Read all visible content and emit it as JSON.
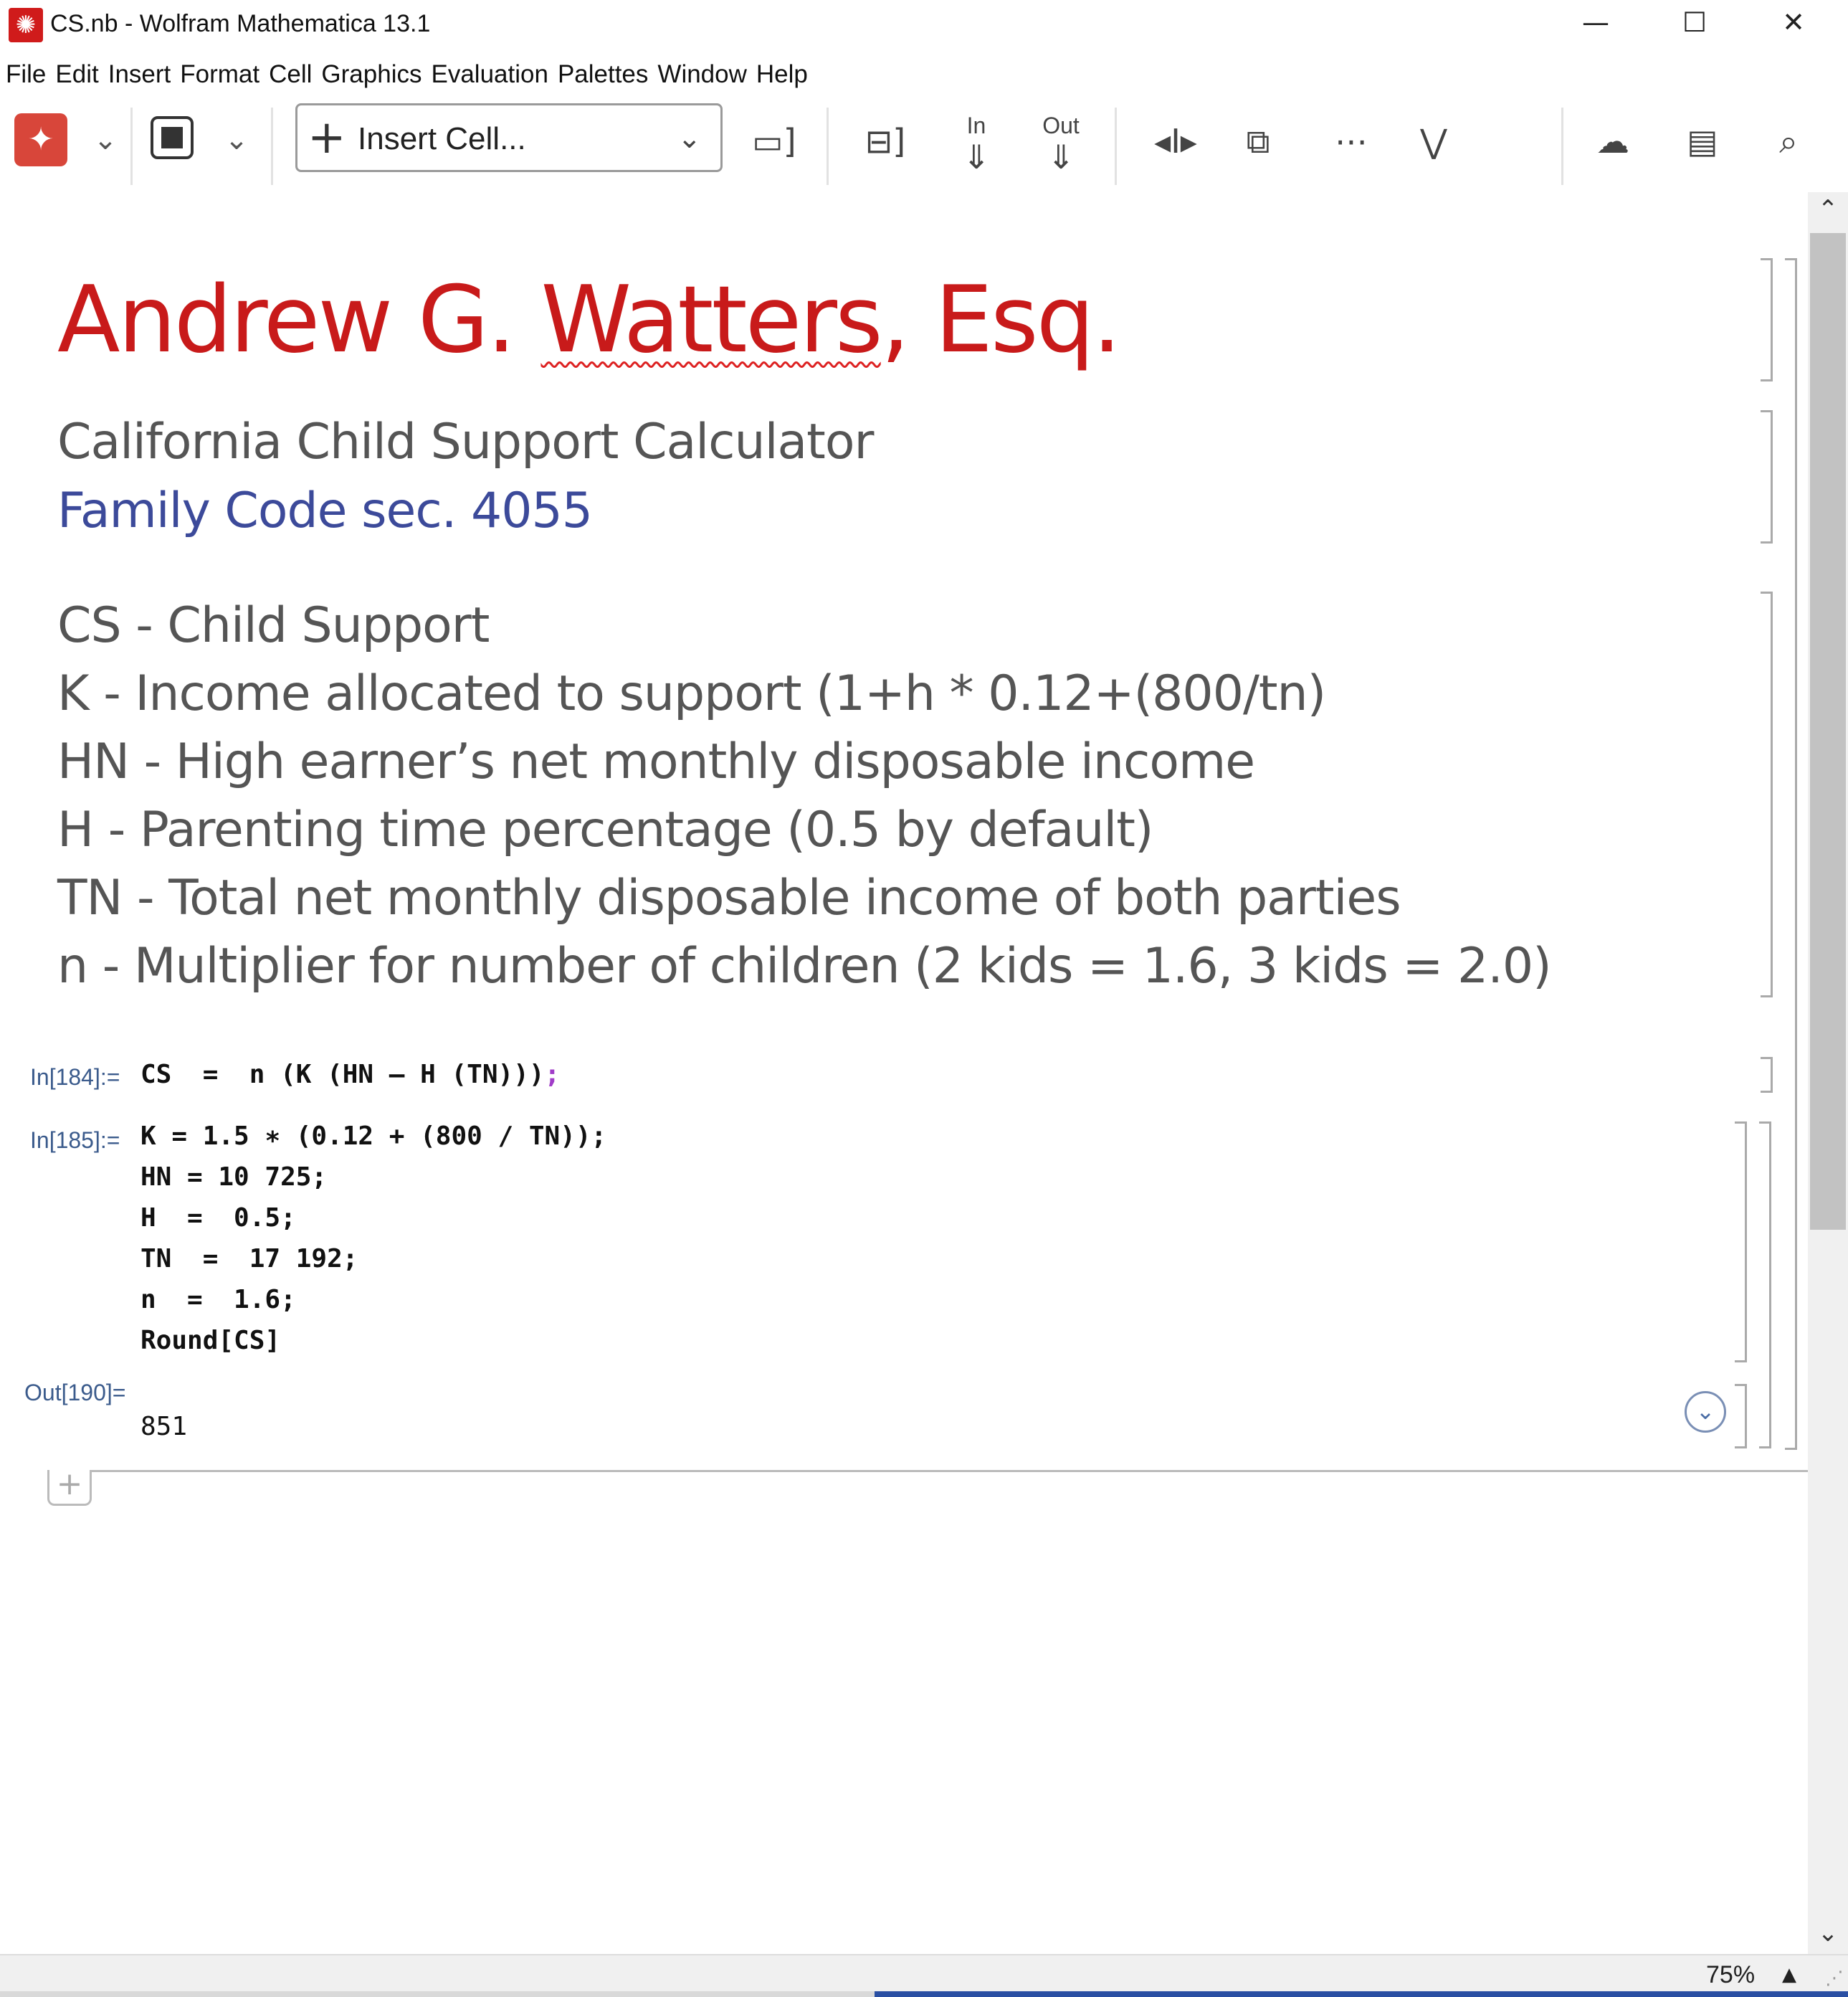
{
  "window": {
    "title": "CS.nb - Wolfram Mathematica 13.1",
    "minimize": "—",
    "maximize": "☐",
    "close": "✕"
  },
  "menu": [
    "File",
    "Edit",
    "Insert",
    "Format",
    "Cell",
    "Graphics",
    "Evaluation",
    "Palettes",
    "Window",
    "Help"
  ],
  "toolbar": {
    "insert_cell_label": "Insert Cell...",
    "in_label": "In",
    "out_label": "Out"
  },
  "notebook": {
    "title_part1": "Andrew G. ",
    "title_part2": "Watters",
    "title_part3": ", Esq.",
    "subtitle": "California Child Support Calculator",
    "subsubtitle": "Family Code sec. 4055",
    "definitions": [
      "CS - Child Support",
      "K - Income allocated to support (1+h * 0.12+(800/tn)",
      "HN - High earner’s net monthly disposable income",
      "H - Parenting time percentage (0.5 by default)",
      "TN - Total net monthly disposable income of both parties",
      "n - Multiplier for number of children (2 kids = 1.6, 3 kids = 2.0)"
    ],
    "cells": [
      {
        "label": "In[184]:=",
        "code": "CS  =  n (K (HN – H (TN)))",
        "terminator": ";"
      },
      {
        "label": "In[185]:=",
        "lines": [
          "K = 1.5 ∗ (0.12 + (800 / TN));",
          "HN = 10 725;",
          "H  =  0.5;",
          "TN  =  17 192;",
          "n  =  1.6;",
          "Round[CS]"
        ]
      },
      {
        "label": "Out[190]=",
        "value": "851"
      }
    ]
  },
  "status": {
    "zoom": "75%"
  },
  "colors": {
    "title_red": "#c81a1a",
    "subsub_blue": "#3c4a9a",
    "label_blue": "#3b5b8c",
    "eval_red": "#d8463a"
  }
}
